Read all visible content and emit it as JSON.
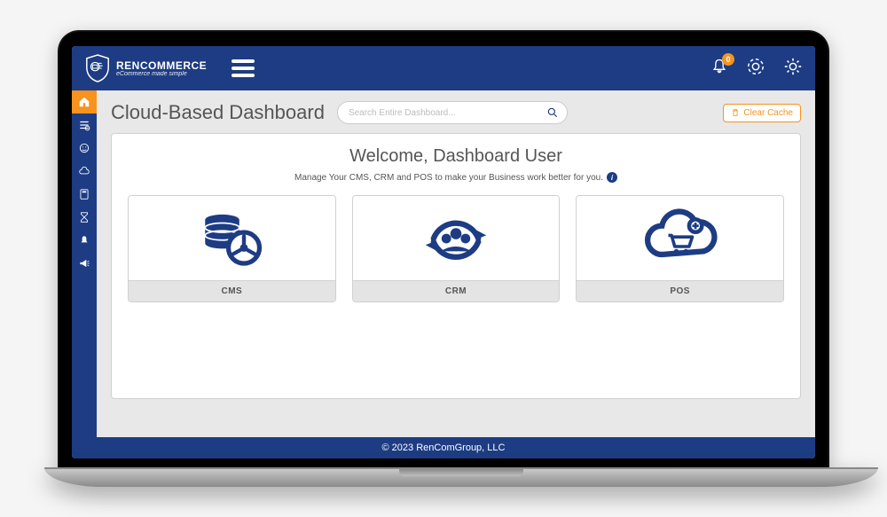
{
  "brand": {
    "name_prefix": "REN",
    "name_suffix": "COMMERCE",
    "tagline": "eCommerce made simple"
  },
  "topbar": {
    "notification_count": "0"
  },
  "header": {
    "title": "Cloud-Based Dashboard",
    "search_placeholder": "Search Entire Dashboard...",
    "clear_cache_label": "Clear Cache"
  },
  "welcome": {
    "title": "Welcome, Dashboard User",
    "subtitle": "Manage Your CMS, CRM and POS to make your Business work better for you."
  },
  "cards": [
    {
      "label": "CMS"
    },
    {
      "label": "CRM"
    },
    {
      "label": "POS"
    }
  ],
  "footer": {
    "copyright": "© 2023 RenComGroup, LLC"
  }
}
